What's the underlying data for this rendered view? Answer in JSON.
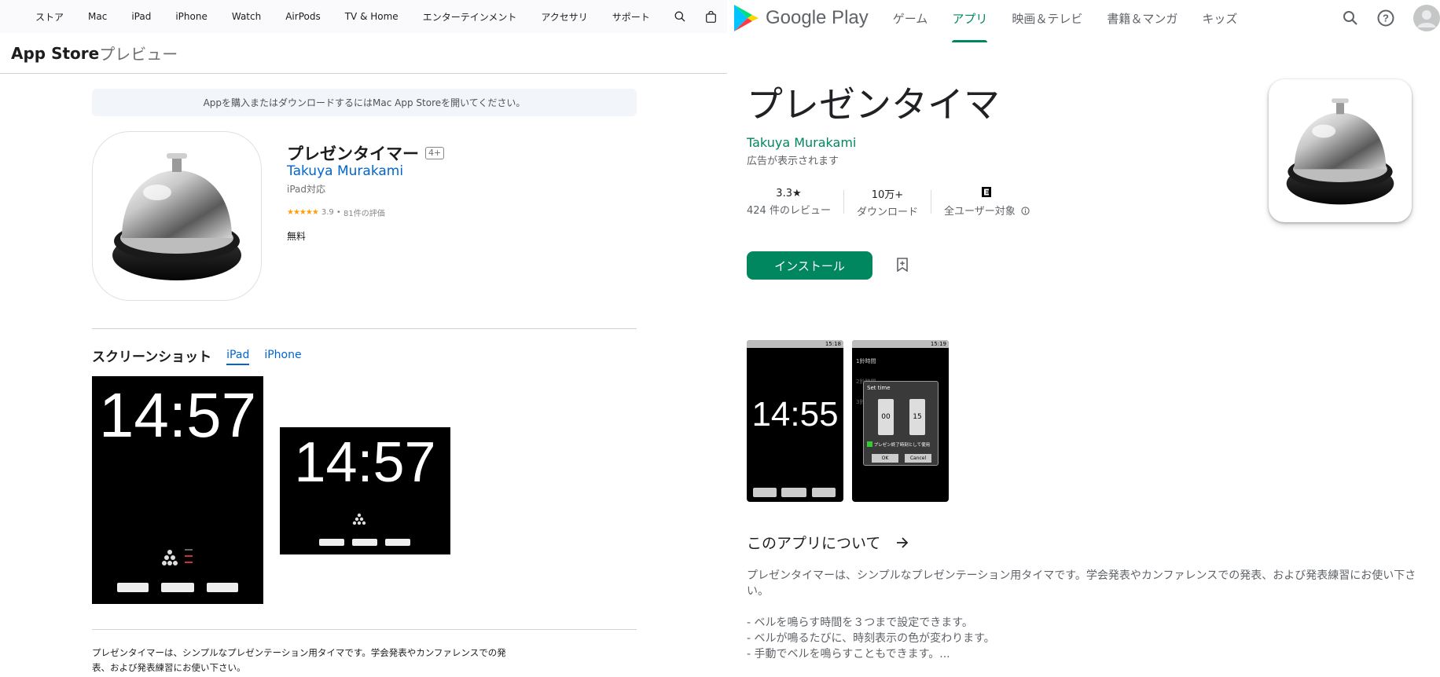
{
  "appstore": {
    "globalnav": {
      "items": [
        "ストア",
        "Mac",
        "iPad",
        "iPhone",
        "Watch",
        "AirPods",
        "TV & Home",
        "エンターテインメント",
        "アクセサリ",
        "サポート"
      ],
      "icons": [
        "apple-logo",
        "search-icon",
        "bag-icon"
      ]
    },
    "subnav": {
      "brand": "App Store",
      "brand_sub": "プレビュー"
    },
    "banner": "Appを購入またはダウンロードするにはMac App Storeを開いてください。",
    "app": {
      "title": "プレゼンタイマー",
      "age_rating": "4+",
      "developer": "Takuya Murakami",
      "compat": "iPad対応",
      "rating": "3.9",
      "rating_count": "81件の評価",
      "price": "無料"
    },
    "screenshots": {
      "title": "スクリーンショット",
      "tabs": [
        "iPad",
        "iPhone"
      ],
      "active_tab": "iPad",
      "clock_1": "14:57",
      "clock_2": "14:57"
    },
    "description": "プレゼンタイマーは、シンプルなプレゼンテーション用タイマです。学会発表やカンファレンスでの発表、および発表練習にお使い下さい。"
  },
  "gplay": {
    "logo_text": "Google Play",
    "tabs": [
      "ゲーム",
      "アプリ",
      "映画＆テレビ",
      "書籍＆マンガ",
      "キッズ"
    ],
    "active_tab": "アプリ",
    "header_icons": [
      "search-icon",
      "help-icon",
      "account-icon"
    ],
    "app": {
      "title": "プレゼンタイマ",
      "developer": "Takuya Murakami",
      "ads_note": "広告が表示されます"
    },
    "stats": {
      "rating_value": "3.3★",
      "rating_label": "424 件のレビュー",
      "downloads_value": "10万+",
      "downloads_label": "ダウンロード",
      "content_label": "全ユーザー対象"
    },
    "install_label": "インストール",
    "screenshot": {
      "clock": "14:55",
      "dialog_title": "Set time",
      "minutes": "00",
      "seconds": "15",
      "checkbox_label": "プレゼン終了時刻として使用",
      "ok": "OK",
      "cancel": "Cancel",
      "list_1": "1鈴時間",
      "list_2": "2鈴時間",
      "list_3": "3鈴時間",
      "status_time_1": "15:18",
      "status_time_2": "15:19"
    },
    "about_title": "このアプリについて",
    "description": "プレゼンタイマーは、シンプルなプレゼンテーション用タイマです。学会発表やカンファレンスでの発表、および発表練習にお使い下さい。\n\n- ベルを鳴らす時間を３つまで設定できます。\n- ベルが鳴るたびに、時刻表示の色が変わります。\n- 手動でベルを鳴らすこともできます。..."
  },
  "colors": {
    "apple_link": "#0066cc",
    "play_green": "#01875f",
    "star_orange": "#ff9f0a"
  }
}
